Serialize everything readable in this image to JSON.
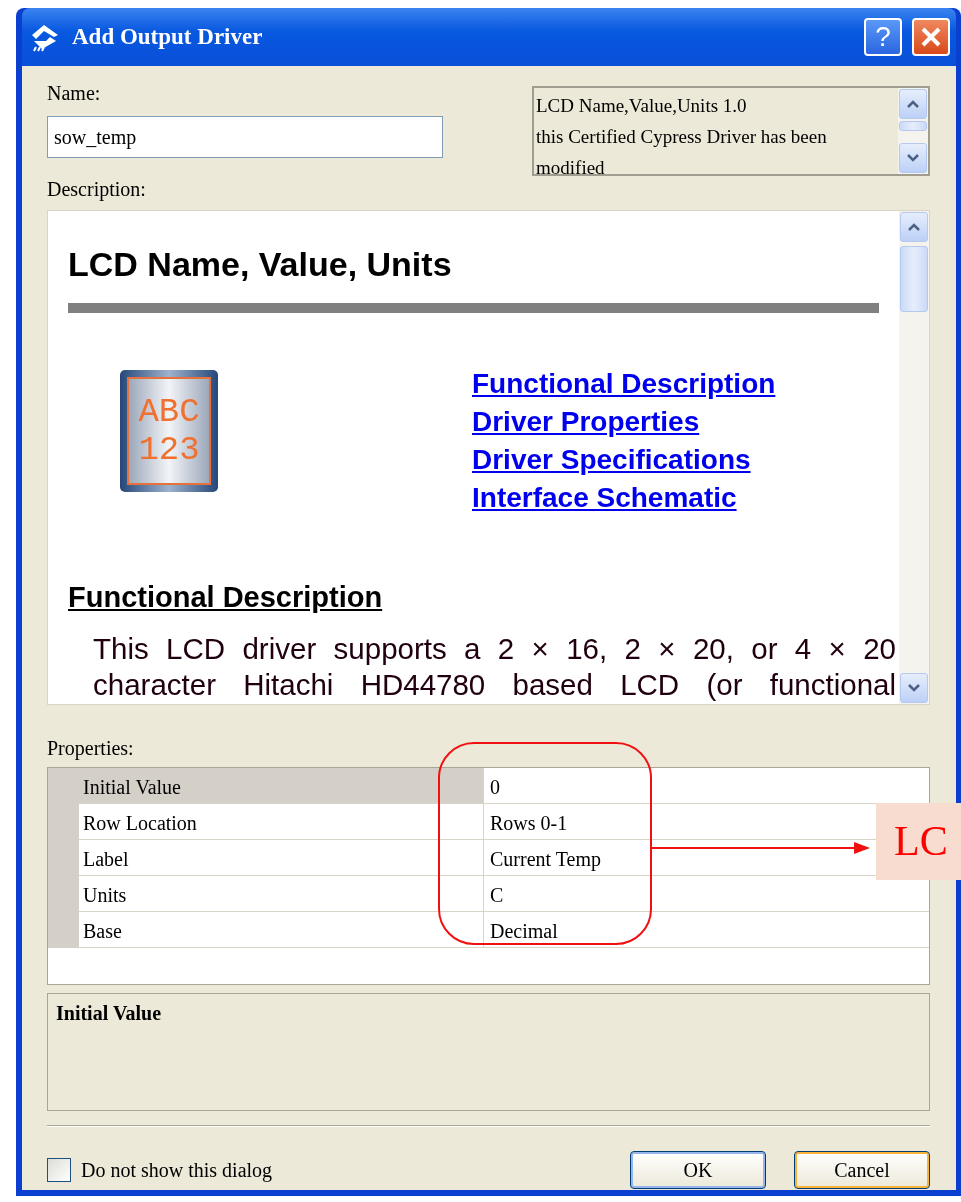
{
  "window": {
    "title": "Add Output Driver",
    "help_button": "?"
  },
  "name": {
    "label": "Name:",
    "value": "sow_temp"
  },
  "info_box": {
    "lines": [
      "LCD Name,Value,Units 1.0",
      "this Certified Cypress Driver has been",
      "modified"
    ]
  },
  "description": {
    "label": "Description:",
    "heading": "LCD Name, Value, Units",
    "icon_text": [
      "ABC",
      "123"
    ],
    "links": [
      "Functional Description",
      "Driver Properties",
      "Driver Specifications",
      "Interface Schematic"
    ],
    "section_heading": "Functional Description",
    "paragraph": "This LCD driver supports a 2 × 16, 2 × 20, or 4 × 20 character Hitachi HD44780 based LCD (or functional"
  },
  "properties": {
    "label": "Properties:",
    "rows": [
      {
        "name": "Initial Value",
        "value": "0",
        "selected": true
      },
      {
        "name": "Row Location",
        "value": "Rows 0-1",
        "selected": false
      },
      {
        "name": "Label",
        "value": "Current Temp",
        "selected": false
      },
      {
        "name": "Units",
        "value": "C",
        "selected": false
      },
      {
        "name": "Base",
        "value": "Decimal",
        "selected": false
      }
    ]
  },
  "help": {
    "title": "Initial Value"
  },
  "footer": {
    "checkbox": {
      "label": "Do not show this dialog",
      "checked": false
    },
    "buttons": [
      {
        "label": "OK",
        "focused": false
      },
      {
        "label": "Cancel",
        "focused": true
      }
    ]
  },
  "annotation": {
    "text": "LC"
  }
}
